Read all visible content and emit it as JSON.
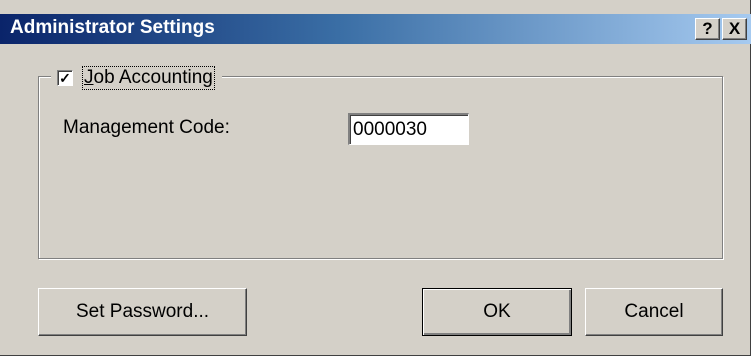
{
  "window": {
    "title": "Administrator Settings",
    "help_label": "?",
    "close_label": "X"
  },
  "group": {
    "checkbox_label": "Job Accounting",
    "checkbox_checked": true,
    "check_glyph": "✓"
  },
  "management_code": {
    "label": "Management Code:",
    "value": "0000030"
  },
  "buttons": {
    "set_password": "Set Password...",
    "ok": "OK",
    "cancel": "Cancel"
  },
  "colors": {
    "title_bar_start": "#0a246a",
    "title_bar_end": "#a6caf0",
    "dialog_face": "#d4d0c8"
  }
}
